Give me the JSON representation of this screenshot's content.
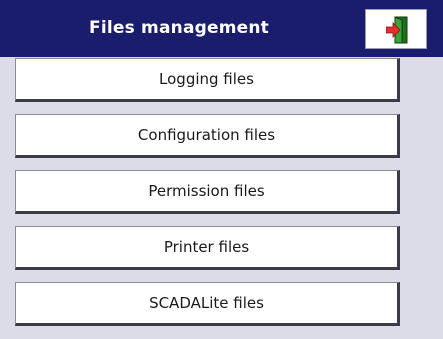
{
  "header": {
    "title": "Files management",
    "exit_icon": "exit-door-icon",
    "title_bar_color": "#1a1c6e"
  },
  "menu": {
    "items": [
      {
        "label": "Logging files"
      },
      {
        "label": "Configuration files"
      },
      {
        "label": "Permission files"
      },
      {
        "label": "Printer files"
      },
      {
        "label": "SCADALite files"
      }
    ]
  },
  "colors": {
    "background": "#dcdce6",
    "button_face": "#ffffff",
    "exit_arrow": "#e03030",
    "exit_door": "#2a8a2a"
  }
}
